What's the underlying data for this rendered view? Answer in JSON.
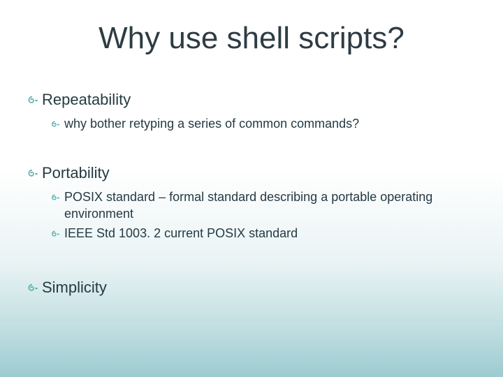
{
  "title": "Why use shell scripts?",
  "items": [
    {
      "label": "Repeatability",
      "subs": [
        {
          "text": "why bother retyping a series of common commands?"
        }
      ]
    },
    {
      "label": "Portability",
      "subs": [
        {
          "text": "POSIX standard – formal standard describing a portable operating environment"
        },
        {
          "text": "IEEE Std 1003. 2 current POSIX standard"
        }
      ]
    },
    {
      "label": "Simplicity",
      "subs": []
    }
  ],
  "colors": {
    "text": "#253a44",
    "bullet": "#4aa8a8"
  }
}
